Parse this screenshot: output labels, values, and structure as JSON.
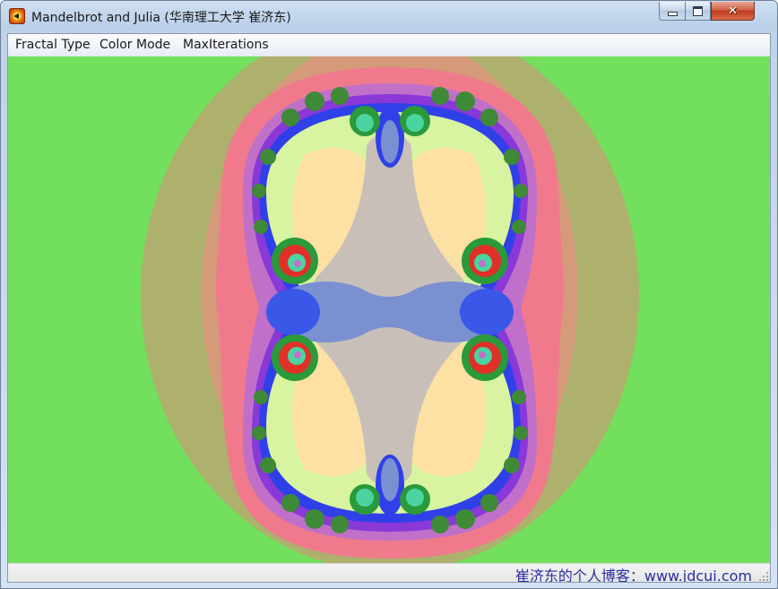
{
  "window": {
    "title": "Mandelbrot and Julia (华南理工大学 崔济东)",
    "app_icon": "fractal-app-icon",
    "controls": {
      "minimize_icon": "minimize-icon",
      "maximize_icon": "maximize-icon",
      "close_icon": "close-icon"
    }
  },
  "menubar": {
    "items": [
      {
        "label": "Fractal Type"
      },
      {
        "label": "Color Mode"
      },
      {
        "label": "MaxIterations"
      }
    ]
  },
  "fractal_view": {
    "background_color": "#72e05c",
    "palette": [
      "#72e05c",
      "#aeb06e",
      "#d49a7a",
      "#f07a8c",
      "#c070c8",
      "#8a38d8",
      "#3040e8",
      "#7a90d0",
      "#c8c0b8",
      "#fde0a4",
      "#d8f4a0",
      "#b4e086",
      "#7ccc64",
      "#2a9a3a",
      "#e03028",
      "#4ad4a0"
    ]
  },
  "statusbar": {
    "text": "崔济东的个人博客：www.jdcui.com"
  }
}
